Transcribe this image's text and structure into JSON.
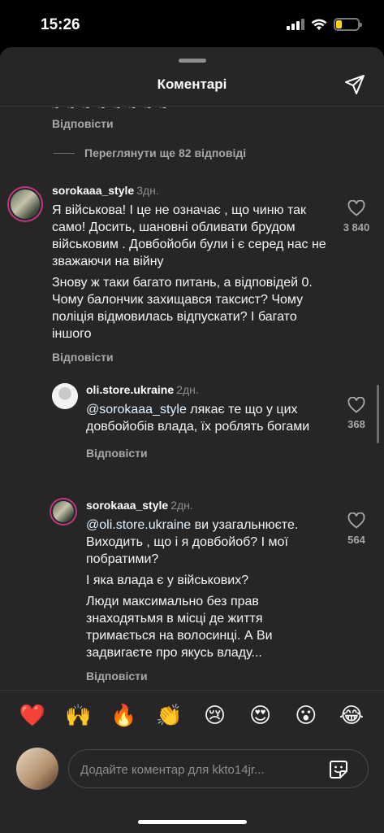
{
  "status": {
    "time": "15:26"
  },
  "header": {
    "title": "Коментарі"
  },
  "thread_top": {
    "partial_text": "~ ~ ~ ~ ~ ~ ~ ~",
    "reply_label": "Відповісти",
    "view_more": "Переглянути ще 82 відповіді"
  },
  "comments": [
    {
      "username": "sorokaaa_style",
      "time": "3дн.",
      "paragraphs": [
        "Я військова! І це не означає , що чиню так само! Досить, шановні обливати брудом військовим . Довбойоби були і є серед нас не зважаючи на війну",
        "Знову ж таки багато питань, а відповідей 0. Чому балончик захищався таксист? Чому поліція відмовилась відпускати? І багато іншого"
      ],
      "likes": "3 840",
      "reply_label": "Відповісти"
    },
    {
      "username": "oli.store.ukraine",
      "time": "2дн.",
      "mention": "@sorokaaa_style",
      "text": " лякає те що у цих довбойобів влада, їх роблять богами",
      "likes": "368",
      "reply_label": "Відповісти"
    },
    {
      "username": "sorokaaa_style",
      "time": "2дн.",
      "mention": "@oli.store.ukraine",
      "text": " ви узагальнюєте. Виходить , що і я довбойоб? І мої побратими?",
      "paragraphs": [
        "І яка влада є у військових?",
        "Люди максимально без прав знаходятьмя в місці де життя тримається на волосинці. А Ви задвигаєте про якусь владу..."
      ],
      "likes": "564",
      "reply_label": "Відповісти"
    }
  ],
  "emojis": [
    "❤️",
    "🙌",
    "🔥",
    "👏",
    "😢",
    "😍",
    "😮",
    "😂"
  ],
  "composer": {
    "placeholder": "Додайте коментар для kkto14jr..."
  },
  "colors": {
    "sheet": "#262626",
    "background": "#000000",
    "secondary_text": "#a8a8a8",
    "battery": "#ffd60a"
  }
}
